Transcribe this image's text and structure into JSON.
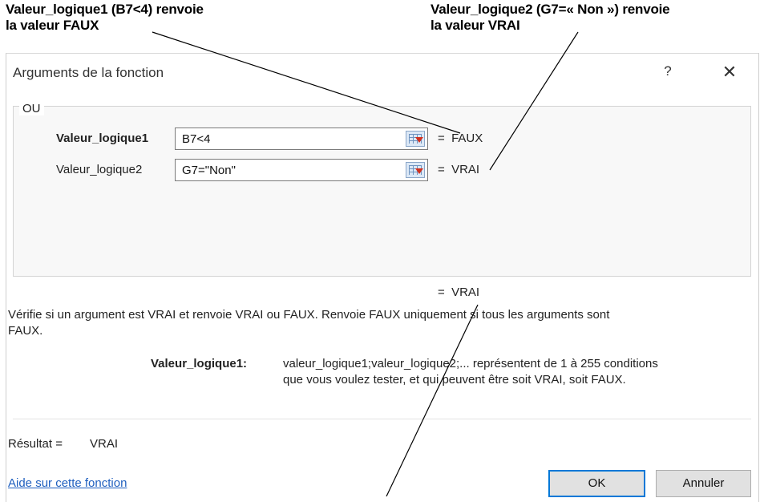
{
  "callouts": {
    "left": {
      "line1": "Valeur_logique1 (B7<4) renvoie",
      "line2": "la valeur FAUX"
    },
    "right": {
      "line1": "Valeur_logique2 (G7=« Non ») renvoie",
      "line2": "la valeur VRAI"
    }
  },
  "dialog": {
    "title": "Arguments de la fonction",
    "help_glyph": "?",
    "close_glyph": "✕",
    "function_name": "OU",
    "args": [
      {
        "label": "Valeur_logique1",
        "value": "B7<4",
        "result": "=  FAUX"
      },
      {
        "label": "Valeur_logique2",
        "value": "G7=\"Non\"",
        "result": "=  VRAI"
      }
    ],
    "formula_result": "=  VRAI",
    "description": "Vérifie si un argument est VRAI et renvoie VRAI ou FAUX. Renvoie FAUX uniquement si tous les arguments sont FAUX.",
    "description_line1": "Vérifie si un argument est VRAI et renvoie VRAI ou FAUX. Renvoie FAUX uniquement si tous les arguments sont",
    "description_line2": "FAUX.",
    "arg_help_label": "Valeur_logique1:",
    "arg_help_line1": "valeur_logique1;valeur_logique2;... représentent de 1 à 255 conditions",
    "arg_help_line2": "que vous voulez tester, et qui peuvent être soit VRAI, soit FAUX.",
    "result_label": "Résultat =",
    "result_value": "VRAI",
    "help_link": "Aide sur cette fonction",
    "ok_label": "OK",
    "cancel_label": "Annuler"
  },
  "colors": {
    "link": "#1f5fbf",
    "default_button_border": "#0078d7"
  }
}
